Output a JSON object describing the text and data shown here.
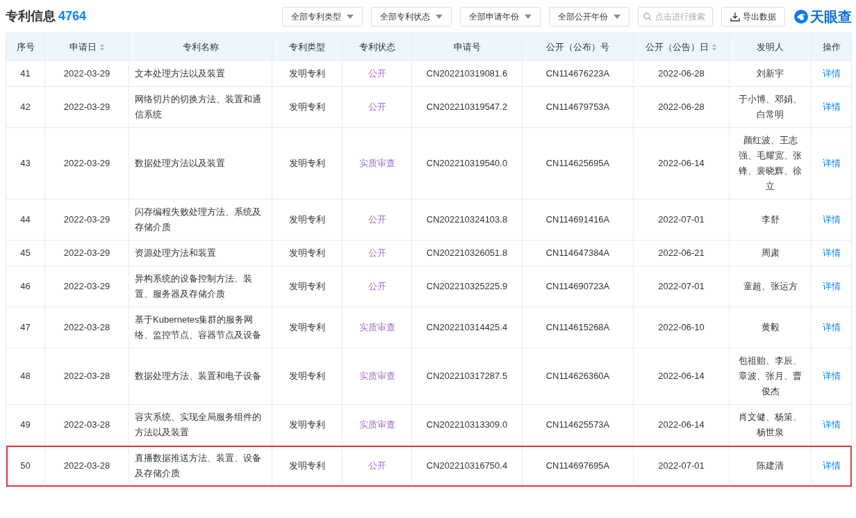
{
  "header": {
    "title": "专利信息",
    "count": "4764",
    "filters": [
      "全部专利类型",
      "全部专利状态",
      "全部申请年份",
      "全部公开年份"
    ],
    "search": {
      "placeholder": "点击进行搜索"
    },
    "export_button": "导出数据",
    "logo": "天眼查"
  },
  "table": {
    "columns": [
      {
        "label": "序号",
        "sortable": false
      },
      {
        "label": "申请日",
        "sortable": true
      },
      {
        "label": "专利名称",
        "sortable": false
      },
      {
        "label": "专利类型",
        "sortable": false
      },
      {
        "label": "专利状态",
        "sortable": false
      },
      {
        "label": "申请号",
        "sortable": false
      },
      {
        "label": "公开（公布）号",
        "sortable": false
      },
      {
        "label": "公开（公告）日",
        "sortable": true
      },
      {
        "label": "发明人",
        "sortable": false
      },
      {
        "label": "操作",
        "sortable": false
      }
    ],
    "rows": [
      {
        "no": "41",
        "apply_date": "2022-03-29",
        "name": "文本处理方法以及装置",
        "type": "发明专利",
        "status": "公开",
        "apply_no": "CN202210319081.6",
        "pub_no": "CN114676223A",
        "pub_date": "2022-06-28",
        "inventors": "刘新宇",
        "action": "详情",
        "highlighted": false
      },
      {
        "no": "42",
        "apply_date": "2022-03-29",
        "name": "网络切片的切换方法、装置和通信系统",
        "type": "发明专利",
        "status": "公开",
        "apply_no": "CN202210319547.2",
        "pub_no": "CN114679753A",
        "pub_date": "2022-06-28",
        "inventors": "于小博、邓娟、白常明",
        "action": "详情",
        "highlighted": false
      },
      {
        "no": "43",
        "apply_date": "2022-03-29",
        "name": "数据处理方法以及装置",
        "type": "发明专利",
        "status": "实质审查",
        "apply_no": "CN202210319540.0",
        "pub_no": "CN114625695A",
        "pub_date": "2022-06-14",
        "inventors": "颜红波、王志强、毛耀宽、张锋、裴晓辉、徐立",
        "action": "详情",
        "highlighted": false
      },
      {
        "no": "44",
        "apply_date": "2022-03-29",
        "name": "闪存编程失败处理方法、系统及存储介质",
        "type": "发明专利",
        "status": "公开",
        "apply_no": "CN202210324103.8",
        "pub_no": "CN114691416A",
        "pub_date": "2022-07-01",
        "inventors": "李舒",
        "action": "详情",
        "highlighted": false
      },
      {
        "no": "45",
        "apply_date": "2022-03-29",
        "name": "资源处理方法和装置",
        "type": "发明专利",
        "status": "公开",
        "apply_no": "CN202210326051.8",
        "pub_no": "CN114647384A",
        "pub_date": "2022-06-21",
        "inventors": "周肃",
        "action": "详情",
        "highlighted": false
      },
      {
        "no": "46",
        "apply_date": "2022-03-29",
        "name": "异构系统的设备控制方法、装置、服务器及存储介质",
        "type": "发明专利",
        "status": "公开",
        "apply_no": "CN202210325225.9",
        "pub_no": "CN114690723A",
        "pub_date": "2022-07-01",
        "inventors": "童超、张运方",
        "action": "详情",
        "highlighted": false
      },
      {
        "no": "47",
        "apply_date": "2022-03-28",
        "name": "基于Kubernetes集群的服务网络、监控节点、容器节点及设备",
        "type": "发明专利",
        "status": "实质审查",
        "apply_no": "CN202210314425.4",
        "pub_no": "CN114615268A",
        "pub_date": "2022-06-10",
        "inventors": "黄毅",
        "action": "详情",
        "highlighted": false
      },
      {
        "no": "48",
        "apply_date": "2022-03-28",
        "name": "数据处理方法、装置和电子设备",
        "type": "发明专利",
        "status": "实质审查",
        "apply_no": "CN202210317287.5",
        "pub_no": "CN114626360A",
        "pub_date": "2022-06-14",
        "inventors": "包祖贻、李辰、章波、张月、曹俊杰",
        "action": "详情",
        "highlighted": false
      },
      {
        "no": "49",
        "apply_date": "2022-03-28",
        "name": "容灾系统、实现全局服务组件的方法以及装置",
        "type": "发明专利",
        "status": "实质审查",
        "apply_no": "CN202210313309.0",
        "pub_no": "CN114625573A",
        "pub_date": "2022-06-14",
        "inventors": "肖文健、杨策、杨世泉",
        "action": "详情",
        "highlighted": false
      },
      {
        "no": "50",
        "apply_date": "2022-03-28",
        "name": "直播数据推送方法、装置、设备及存储介质",
        "type": "发明专利",
        "status": "公开",
        "apply_no": "CN202210316750.4",
        "pub_no": "CN114697695A",
        "pub_date": "2022-07-01",
        "inventors": "陈建清",
        "action": "详情",
        "highlighted": true
      }
    ]
  }
}
